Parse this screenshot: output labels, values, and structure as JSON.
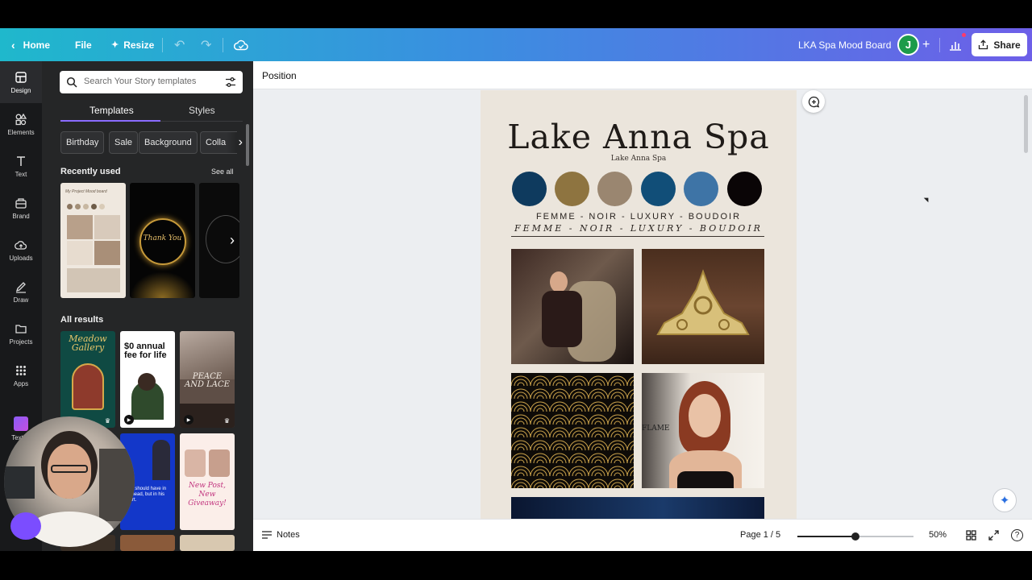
{
  "topbar": {
    "home_label": "Home",
    "file_label": "File",
    "resize_label": "Resize",
    "doc_title": "LKA Spa Mood Board",
    "avatar_initial": "J",
    "share_label": "Share"
  },
  "rail": {
    "items": [
      {
        "label": "Design",
        "icon": "design-icon"
      },
      {
        "label": "Elements",
        "icon": "elements-icon"
      },
      {
        "label": "Text",
        "icon": "text-icon"
      },
      {
        "label": "Brand",
        "icon": "brand-icon"
      },
      {
        "label": "Uploads",
        "icon": "uploads-icon"
      },
      {
        "label": "Draw",
        "icon": "draw-icon"
      },
      {
        "label": "Projects",
        "icon": "folder-icon"
      },
      {
        "label": "Apps",
        "icon": "apps-icon"
      },
      {
        "label": "Text to",
        "icon": "text-to-image-icon"
      }
    ]
  },
  "panel": {
    "search_placeholder": "Search Your Story templates",
    "tabs": [
      "Templates",
      "Styles"
    ],
    "chips": [
      "Birthday",
      "Sale",
      "Background",
      "Colla"
    ],
    "recently_used_title": "Recently used",
    "see_all_label": "See all",
    "all_results_title": "All results",
    "recent_thumbs": [
      {
        "caption": "My Project Mood board"
      },
      {
        "caption": "Thank You"
      }
    ],
    "result_thumbs": [
      {
        "caption": "Meadow Gallery"
      },
      {
        "caption": "$0 annual fee for life"
      },
      {
        "caption": "PEACE AND LACE"
      },
      {
        "caption": "man should have in his head, but in his heart."
      },
      {
        "caption": "New Post, New Giveaway!"
      }
    ]
  },
  "toolbar": {
    "position_label": "Position"
  },
  "page": {
    "title": "Lake Anna Spa",
    "subtitle": "Lake Anna Spa",
    "tagline": "FEMME - NOIR - LUXURY - BOUDOIR",
    "tagline_italic": "FEMME - NOIR - LUXURY - BOUDOIR",
    "photo_caption": "FLAME"
  },
  "palette": [
    "#0e3a5e",
    "#8e7440",
    "#9a8670",
    "#114e78",
    "#3e74a6",
    "#0a0506"
  ],
  "bottombar": {
    "notes_label": "Notes",
    "page_indicator": "Page 1 / 5",
    "zoom_label": "50%",
    "zoom_fraction": 0.5
  }
}
